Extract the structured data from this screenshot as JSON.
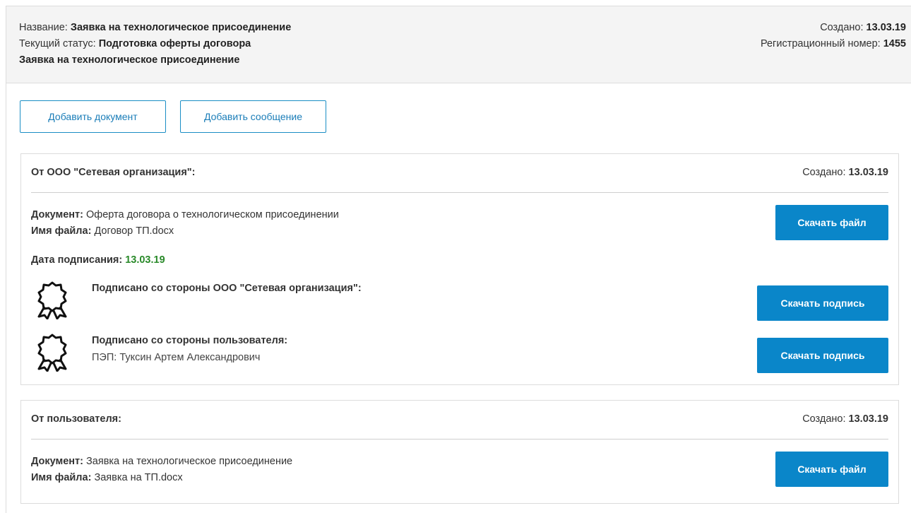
{
  "header": {
    "name_label": "Название:",
    "name_value": "Заявка на технологическое присоединение",
    "status_label": "Текущий статус:",
    "status_value": "Подготовка оферты договора",
    "description": "Заявка на технологическое присоединение",
    "created_label": "Создано:",
    "created_value": "13.03.19",
    "reg_label": "Регистрационный номер:",
    "reg_value": "1455"
  },
  "actions": {
    "add_document": "Добавить документ",
    "add_message": "Добавить сообщение"
  },
  "cards": [
    {
      "from": "От ООО \"Сетевая организация\":",
      "created_label": "Создано:",
      "created_value": "13.03.19",
      "doc_label": "Документ:",
      "doc_value": "Оферта договора о технологическом присоединении",
      "file_label": "Имя файла:",
      "file_value": "Договор ТП.docx",
      "download_label": "Скачать файл",
      "sign_date_label": "Дата подписания:",
      "sign_date_value": "13.03.19",
      "signatures": [
        {
          "title": "Подписано со стороны ООО \"Сетевая организация\":",
          "detail": "",
          "button": "Скачать подпись"
        },
        {
          "title": "Подписано со стороны пользователя:",
          "detail": "ПЭП: Туксин Артем Александрович",
          "button": "Скачать подпись"
        }
      ]
    },
    {
      "from": "От пользователя:",
      "created_label": "Создано:",
      "created_value": "13.03.19",
      "doc_label": "Документ:",
      "doc_value": "Заявка на технологическое присоединение",
      "file_label": "Имя файла:",
      "file_value": "Заявка на ТП.docx",
      "download_label": "Скачать файл"
    }
  ],
  "colors": {
    "accent": "#0a86c9",
    "outline": "#1a8ec5",
    "sign_date": "#2a8a2a",
    "header_bg": "#f4f4f4"
  },
  "icons": {
    "signature": "award-ribbon-icon"
  }
}
